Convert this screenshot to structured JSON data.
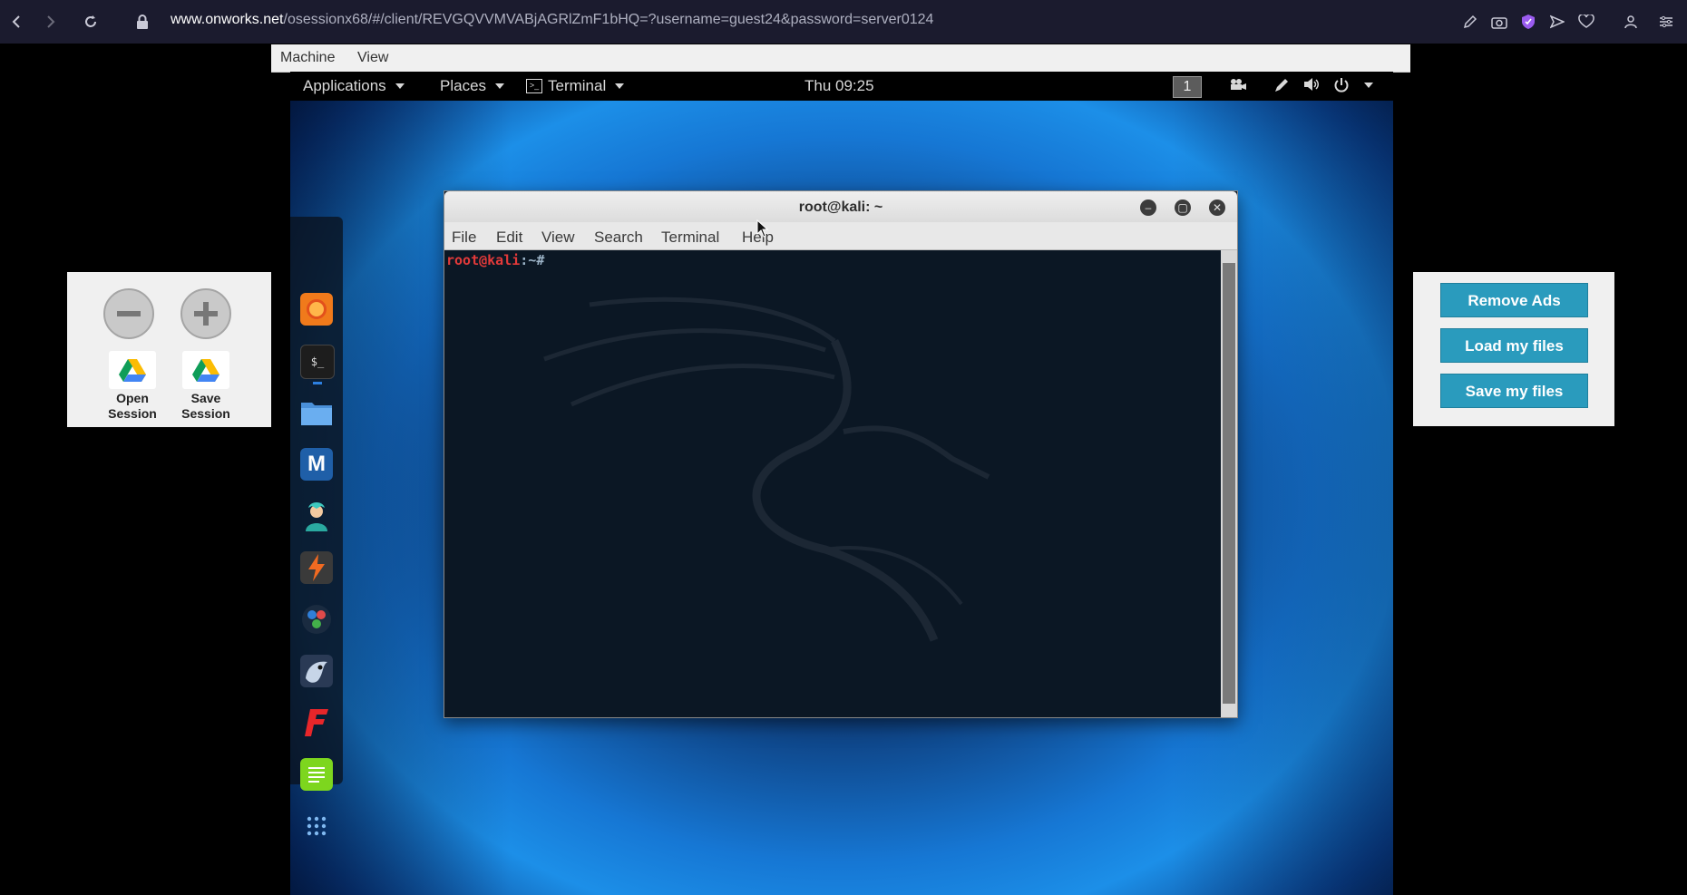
{
  "browser": {
    "url_host": "www.onworks.net",
    "url_path": "/osessionx68/#/client/REVGQVVMVABjAGRlZmF1bHQ=?username=guest24&password=server0124",
    "icons": [
      "back-icon",
      "forward-icon",
      "reload-icon",
      "lock-icon",
      "pen-icon",
      "camera-icon",
      "shield-icon",
      "send-icon",
      "heart-icon",
      "account-icon",
      "settings-icon"
    ]
  },
  "vm_menu": {
    "machine": "Machine",
    "view": "View"
  },
  "top_panel": {
    "applications": "Applications",
    "places": "Places",
    "terminal": "Terminal",
    "clock": "Thu 09:25",
    "workspace": "1"
  },
  "dock": {
    "apps": [
      "firefox-icon",
      "terminal-app-icon",
      "files-icon",
      "metasploit-icon",
      "armitage-icon",
      "burpsuite-icon",
      "maltego-icon",
      "beef-icon",
      "faraday-icon",
      "leafpad-icon",
      "show-apps-icon"
    ]
  },
  "terminal_window": {
    "title": "root@kali: ~",
    "menu": [
      "File",
      "Edit",
      "View",
      "Search",
      "Terminal",
      "Help"
    ],
    "prompt_user": "root@kali",
    "prompt_path": ":~#"
  },
  "left_panel": {
    "open_session": "Open Session",
    "save_session": "Save Session"
  },
  "right_panel": {
    "remove_ads": "Remove Ads",
    "load_files": "Load my files",
    "save_files": "Save my files"
  },
  "colors": {
    "accent_button": "#2a9bbd",
    "prompt_user": "#e33a3a"
  }
}
